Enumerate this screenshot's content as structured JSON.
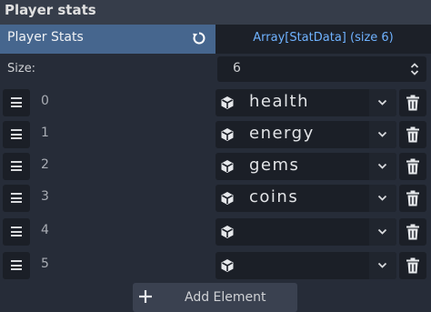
{
  "panel": {
    "title": "Player stats"
  },
  "property": {
    "label": "Player Stats",
    "value": "Array[StatData] (size 6)"
  },
  "size_row": {
    "label": "Size:",
    "value": "6"
  },
  "elements": [
    {
      "index": "0",
      "name": "health"
    },
    {
      "index": "1",
      "name": "energy"
    },
    {
      "index": "2",
      "name": "gems"
    },
    {
      "index": "3",
      "name": "coins"
    },
    {
      "index": "4",
      "name": ""
    },
    {
      "index": "5",
      "name": ""
    }
  ],
  "add_button": {
    "label": "Add Element"
  },
  "icons": {
    "revert": "revert-icon",
    "spin": "spin-arrows-icon",
    "handle": "drag-handle-icon",
    "resource": "cube-icon",
    "dropdown": "chevron-down-icon",
    "remove": "trash-icon",
    "add": "plus-icon"
  },
  "colors": {
    "label_bg": "#46668e",
    "value_text": "#6fb2ff",
    "panel_bg": "#262c38",
    "field_bg": "#1b1f27"
  }
}
